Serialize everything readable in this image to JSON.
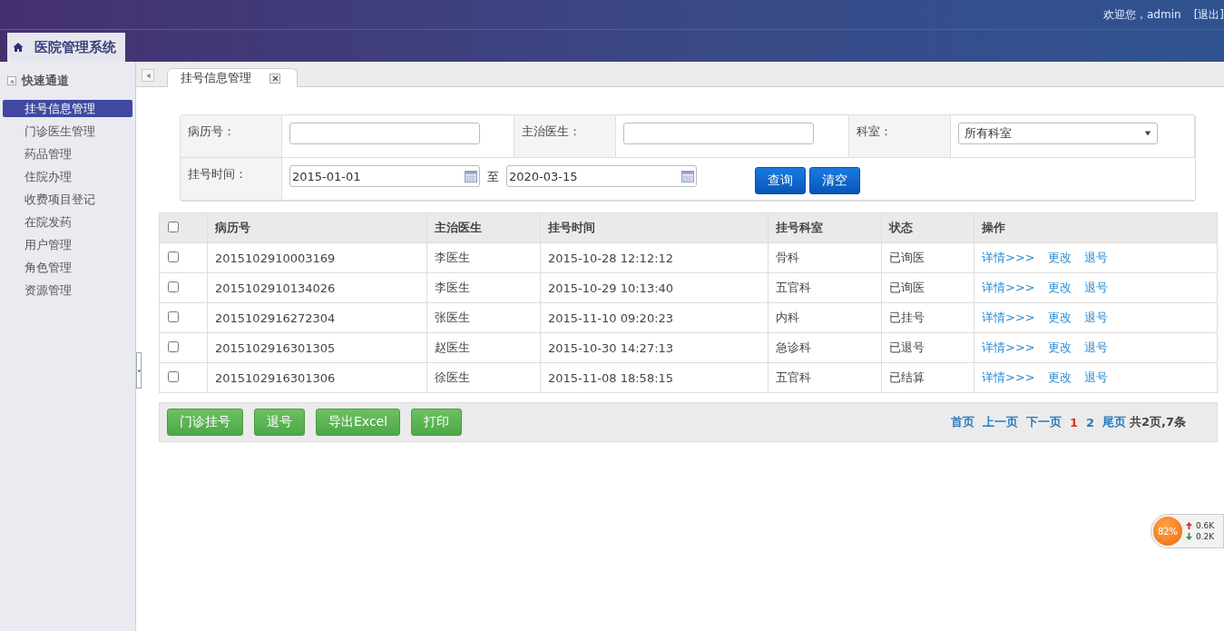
{
  "header": {
    "system_tab": "医院管理系统",
    "welcome": "欢迎您，admin",
    "logout": "[退出]"
  },
  "sidebar": {
    "title": "快速通道",
    "expanded": true,
    "items": [
      {
        "label": "挂号信息管理",
        "selected": true
      },
      {
        "label": "门诊医生管理",
        "selected": false
      },
      {
        "label": "药品管理",
        "selected": false
      },
      {
        "label": "住院办理",
        "selected": false
      },
      {
        "label": "收费项目登记",
        "selected": false
      },
      {
        "label": "在院发药",
        "selected": false
      },
      {
        "label": "用户管理",
        "selected": false
      },
      {
        "label": "角色管理",
        "selected": false
      },
      {
        "label": "资源管理",
        "selected": false
      }
    ]
  },
  "tabs": [
    {
      "label": "挂号信息管理",
      "selected": true
    }
  ],
  "search_form": {
    "fields": [
      {
        "label": "病历号：",
        "kind": "text"
      },
      {
        "label": "主治医生：",
        "kind": "text"
      },
      {
        "label": "科室：",
        "kind": "select",
        "value": "所有科室"
      }
    ],
    "date_range": {
      "label": "挂号时间：",
      "from": "2015-01-01",
      "separator": "至",
      "to": "2020-03-15"
    },
    "buttons": [
      "查询",
      "清空"
    ]
  },
  "table": {
    "select_all_checked": false,
    "columns": [
      "病历号",
      "主治医生",
      "挂号时间",
      "挂号科室",
      "状态",
      "操作"
    ],
    "rows": [
      {
        "checked": false,
        "cells": [
          "2015102910003169",
          "李医生",
          "2015-10-28 12:12:12",
          "骨科",
          "已询医"
        ],
        "actions": [
          "详情>>>",
          "更改",
          "退号"
        ]
      },
      {
        "checked": false,
        "cells": [
          "2015102910134026",
          "李医生",
          "2015-10-29 10:13:40",
          "五官科",
          "已询医"
        ],
        "actions": [
          "详情>>>",
          "更改",
          "退号"
        ]
      },
      {
        "checked": false,
        "cells": [
          "2015102916272304",
          "张医生",
          "2015-11-10 09:20:23",
          "内科",
          "已挂号"
        ],
        "actions": [
          "详情>>>",
          "更改",
          "退号"
        ]
      },
      {
        "checked": false,
        "cells": [
          "2015102916301305",
          "赵医生",
          "2015-10-30 14:27:13",
          "急诊科",
          "已退号"
        ],
        "actions": [
          "详情>>>",
          "更改",
          "退号"
        ]
      },
      {
        "checked": false,
        "cells": [
          "2015102916301306",
          "徐医生",
          "2015-11-08 18:58:15",
          "五官科",
          "已结算"
        ],
        "actions": [
          "详情>>>",
          "更改",
          "退号"
        ]
      }
    ]
  },
  "action_buttons": [
    "门诊挂号",
    "退号",
    "导出Excel",
    "打印"
  ],
  "pagination": {
    "links": [
      {
        "label": "首页",
        "kind": "link"
      },
      {
        "label": "上一页",
        "kind": "link"
      },
      {
        "label": "下一页",
        "kind": "link"
      },
      {
        "label": "1",
        "kind": "page",
        "selected": true
      },
      {
        "label": "2",
        "kind": "page",
        "selected": false
      },
      {
        "label": "尾页",
        "kind": "link"
      }
    ],
    "summary": "共2页,7条"
  },
  "speed_meter": {
    "percent": "82%",
    "up": "0.6K",
    "down": "0.2K"
  }
}
